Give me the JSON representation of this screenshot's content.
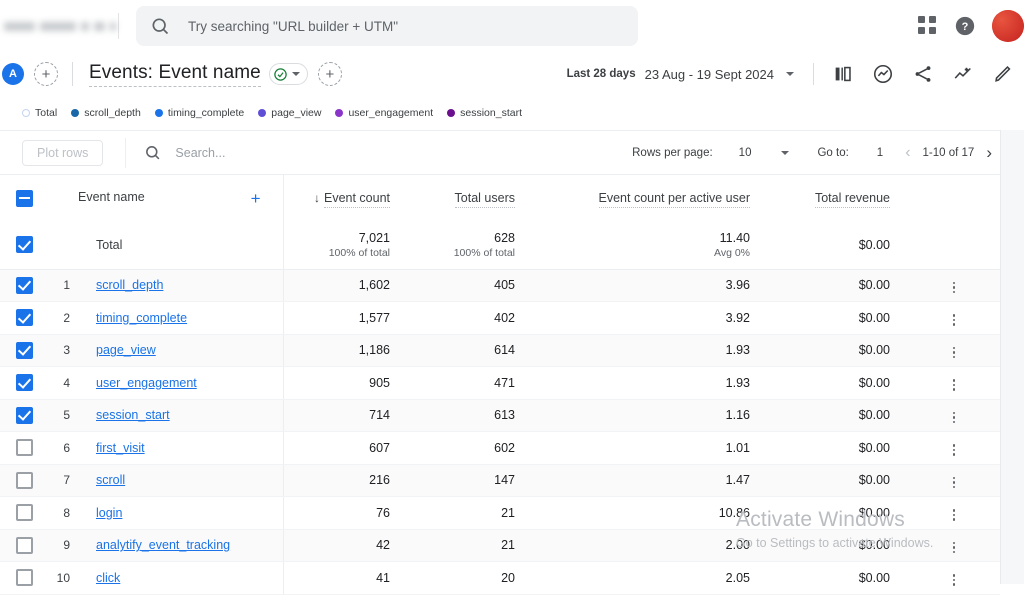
{
  "topbar": {
    "search_placeholder": "Try searching \"URL builder + UTM\"",
    "search_icon": "search-icon",
    "apps_icon": "apps-grid-icon",
    "help_icon": "help-circle-icon",
    "avatar_label": ""
  },
  "titlebar": {
    "segment_badge": "A",
    "add_comparison": "+",
    "title": "Events: Event name",
    "check_icon": "check-circle-icon",
    "add_dimension": "+",
    "date_label": "Last 28 days",
    "date_range": "23 Aug - 19 Sept 2024",
    "icons": [
      {
        "name": "compare-bars-icon"
      },
      {
        "name": "insights-icon"
      },
      {
        "name": "share-icon"
      },
      {
        "name": "trend-line-icon"
      },
      {
        "name": "edit-pencil-icon"
      }
    ]
  },
  "legend": {
    "items": [
      {
        "label": "Total",
        "color": "#ffffff",
        "hollow": true
      },
      {
        "label": "scroll_depth",
        "color": "#1967a8",
        "hollow": false
      },
      {
        "label": "timing_complete",
        "color": "#1a73e8",
        "hollow": false
      },
      {
        "label": "page_view",
        "color": "#5f4fd6",
        "hollow": false
      },
      {
        "label": "user_engagement",
        "color": "#8a35c9",
        "hollow": false
      },
      {
        "label": "session_start",
        "color": "#6b0f8f",
        "hollow": false
      }
    ]
  },
  "toolbar": {
    "plot_rows_label": "Plot rows",
    "search_placeholder": "Search...",
    "search_icon": "search-icon",
    "rows_per_page_label": "Rows per page:",
    "rows_per_page_value": "10",
    "go_to_label": "Go to:",
    "go_to_value": "1",
    "page_range": "1-10 of 17",
    "prev_icon": "chevron-left-icon",
    "next_icon": "chevron-right-icon"
  },
  "table": {
    "headers": {
      "name": "Event name",
      "add_column": "+",
      "event_count": "Event count",
      "total_users": "Total users",
      "per_active_user": "Event count per active user",
      "total_revenue": "Total revenue",
      "sort_indicator": "↓"
    },
    "total_row": {
      "checked": true,
      "label": "Total",
      "event_count": "7,021",
      "event_count_sub": "100% of total",
      "total_users": "628",
      "total_users_sub": "100% of total",
      "per_active_user": "11.40",
      "per_active_user_sub": "Avg 0%",
      "total_revenue": "$0.00"
    },
    "rows": [
      {
        "index": "1",
        "checked": true,
        "name": "scroll_depth",
        "event_count": "1,602",
        "total_users": "405",
        "per_active_user": "3.96",
        "total_revenue": "$0.00"
      },
      {
        "index": "2",
        "checked": true,
        "name": "timing_complete",
        "event_count": "1,577",
        "total_users": "402",
        "per_active_user": "3.92",
        "total_revenue": "$0.00"
      },
      {
        "index": "3",
        "checked": true,
        "name": "page_view",
        "event_count": "1,186",
        "total_users": "614",
        "per_active_user": "1.93",
        "total_revenue": "$0.00"
      },
      {
        "index": "4",
        "checked": true,
        "name": "user_engagement",
        "event_count": "905",
        "total_users": "471",
        "per_active_user": "1.93",
        "total_revenue": "$0.00"
      },
      {
        "index": "5",
        "checked": true,
        "name": "session_start",
        "event_count": "714",
        "total_users": "613",
        "per_active_user": "1.16",
        "total_revenue": "$0.00"
      },
      {
        "index": "6",
        "checked": false,
        "name": "first_visit",
        "event_count": "607",
        "total_users": "602",
        "per_active_user": "1.01",
        "total_revenue": "$0.00"
      },
      {
        "index": "7",
        "checked": false,
        "name": "scroll",
        "event_count": "216",
        "total_users": "147",
        "per_active_user": "1.47",
        "total_revenue": "$0.00"
      },
      {
        "index": "8",
        "checked": false,
        "name": "login",
        "event_count": "76",
        "total_users": "21",
        "per_active_user": "10.86",
        "total_revenue": "$0.00"
      },
      {
        "index": "9",
        "checked": false,
        "name": "analytify_event_tracking",
        "event_count": "42",
        "total_users": "21",
        "per_active_user": "2.00",
        "total_revenue": "$0.00"
      },
      {
        "index": "10",
        "checked": false,
        "name": "click",
        "event_count": "41",
        "total_users": "20",
        "per_active_user": "2.05",
        "total_revenue": "$0.00"
      }
    ]
  },
  "watermark": {
    "line1": "Activate Windows",
    "line2": "Go to Settings to activate Windows."
  },
  "colors": {
    "accent": "#1a73e8",
    "link": "#1a73e8",
    "text": "#202124",
    "muted": "#5f6368"
  }
}
